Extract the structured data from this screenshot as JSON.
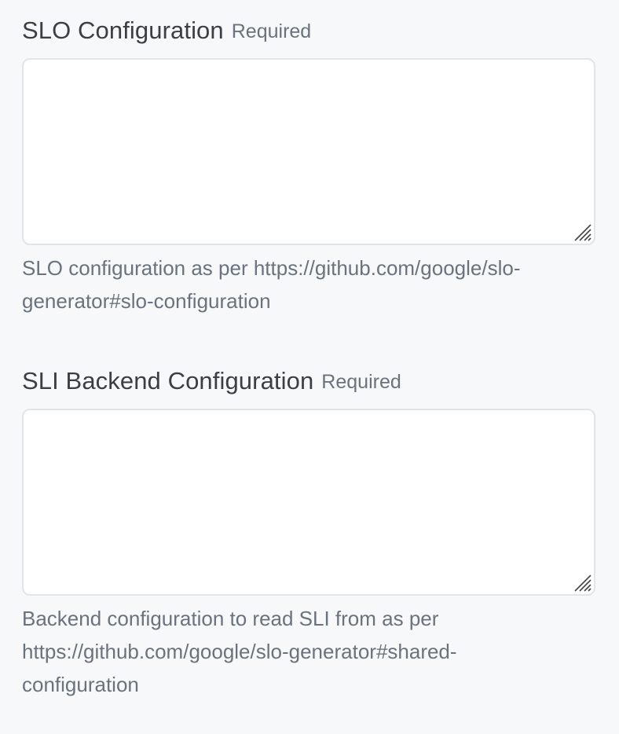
{
  "slo_config": {
    "label": "SLO Configuration",
    "required": "Required",
    "value": "",
    "help_line1": "SLO configuration as per https://github.com/google/slo-",
    "help_line2": "generator#slo-configuration"
  },
  "sli_backend_config": {
    "label": "SLI Backend Configuration",
    "required": "Required",
    "value": "",
    "help_line1": "Backend configuration to read SLI from as per",
    "help_line2": "https://github.com/google/slo-generator#shared-",
    "help_line3": "configuration"
  },
  "icons": {
    "resize": "resize-grip-icon"
  },
  "colors": {
    "background": "#f6f8fa",
    "textarea_border": "#e1e4e8",
    "label_text": "#3b3f44",
    "muted_text": "#6a737d"
  }
}
